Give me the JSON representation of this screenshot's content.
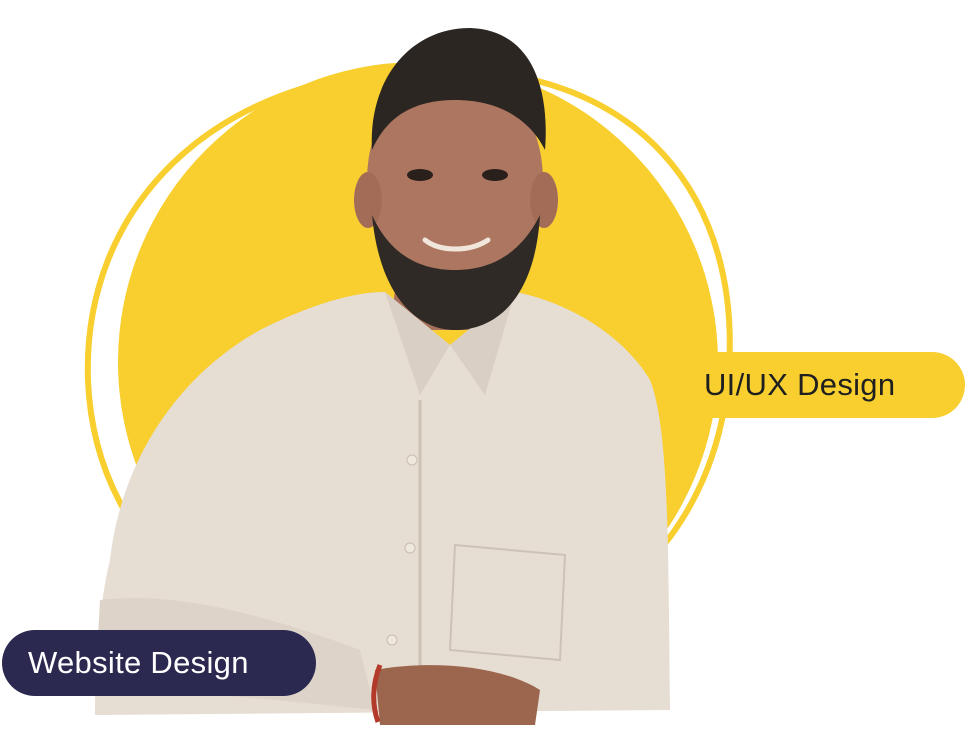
{
  "colors": {
    "accent_yellow": "#f8cf2e",
    "badge_navy": "#2b2950",
    "background": "#ffffff"
  },
  "badges": {
    "uiux": "UI/UX Design",
    "website": "Website Design"
  },
  "image": {
    "subject": "portrait-photo"
  }
}
